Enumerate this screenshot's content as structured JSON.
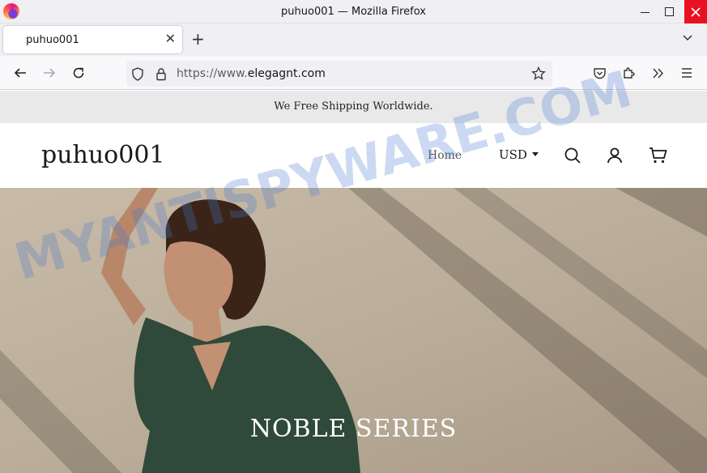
{
  "window": {
    "title": "puhuo001 — Mozilla Firefox"
  },
  "tabs": [
    {
      "label": "puhuo001"
    }
  ],
  "urlbar": {
    "scheme": "https://www.",
    "host": "elegagnt.com"
  },
  "page": {
    "announcement": "We Free Shipping Worldwide.",
    "logo": "puhuo001",
    "nav": {
      "home": "Home"
    },
    "currency": "USD",
    "hero": {
      "title": "NOBLE SERIES"
    }
  },
  "watermark": "MYANTISPYWARE.COM",
  "colors": {
    "chrome_bg": "#f0f0f4",
    "close_red": "#e81123",
    "announce_bg": "#e9e9e9",
    "dress_green": "#2f4a3a"
  }
}
